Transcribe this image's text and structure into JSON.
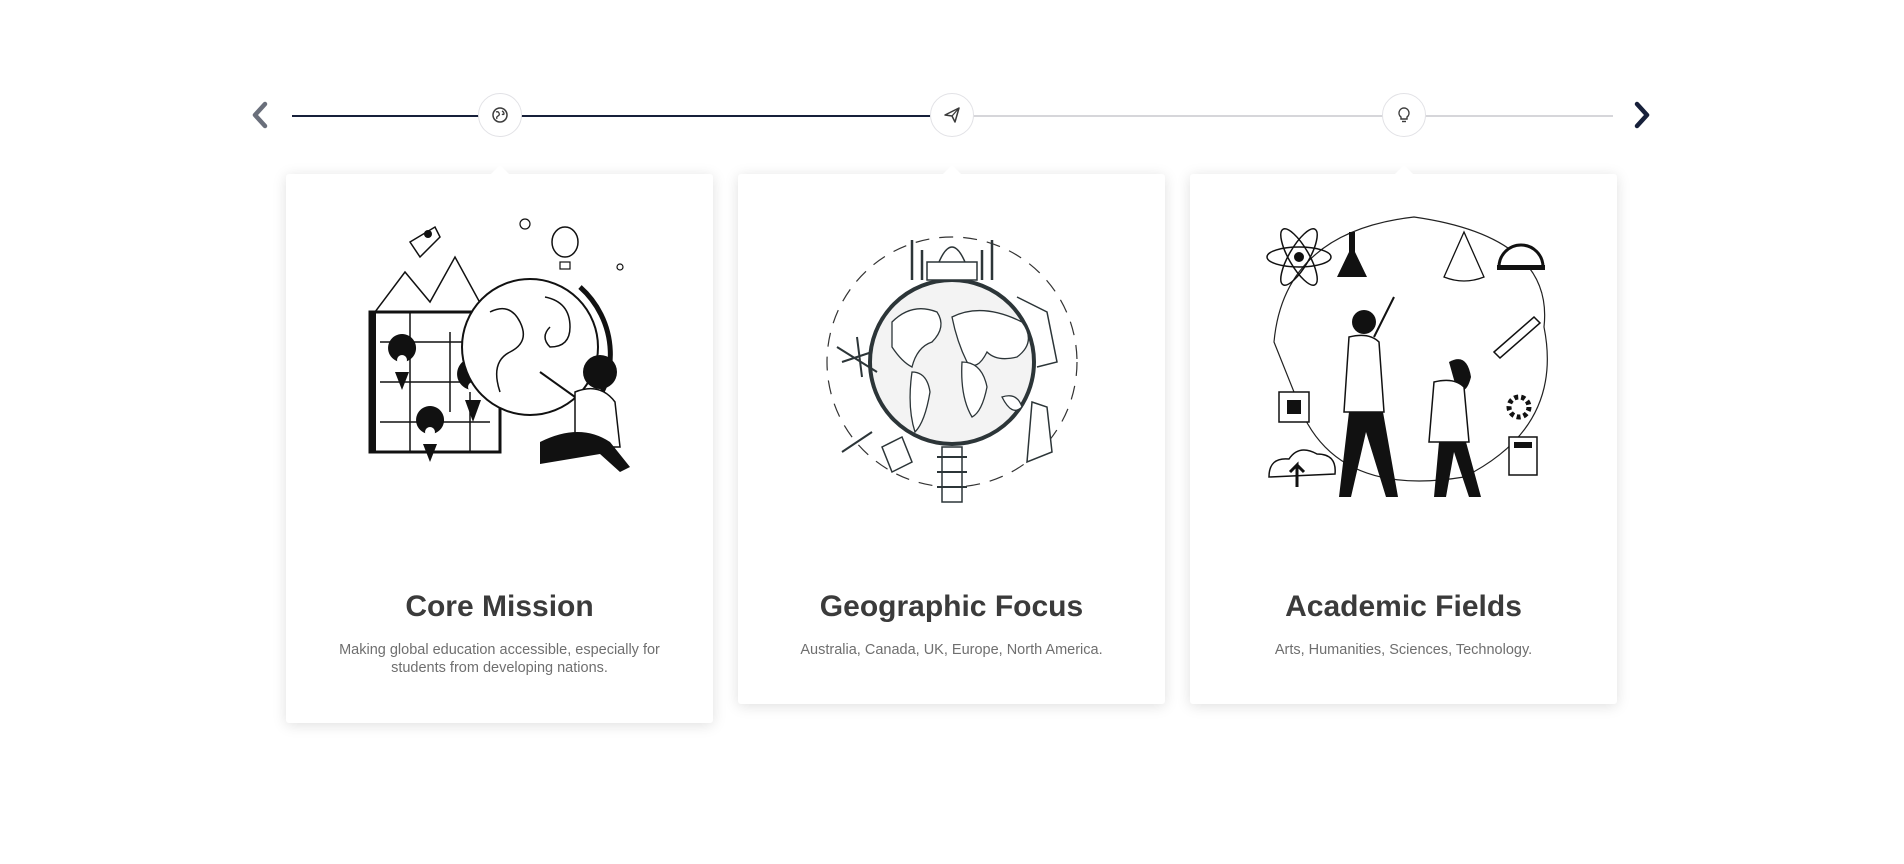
{
  "colors": {
    "accent": "#17203a",
    "track_inactive": "#d6d6da",
    "title": "#3b3b3b",
    "text": "#6f6f6f"
  },
  "navigation": {
    "prev_icon": "chevron-left-icon",
    "next_icon": "chevron-right-icon"
  },
  "steps": [
    {
      "icon": "globe-icon",
      "active": true
    },
    {
      "icon": "paper-plane-icon",
      "active": true
    },
    {
      "icon": "lightbulb-icon",
      "active": false
    }
  ],
  "cards": [
    {
      "title": "Core Mission",
      "description": "Making global education accessible, especially for students from developing nations.",
      "illustration": "globe-map-explorer-illustration"
    },
    {
      "title": "Geographic Focus",
      "description": "Australia, Canada, UK, Europe, North America.",
      "illustration": "world-landmarks-illustration"
    },
    {
      "title": "Academic Fields",
      "description": "Arts, Humanities, Sciences, Technology.",
      "illustration": "science-students-illustration"
    }
  ]
}
